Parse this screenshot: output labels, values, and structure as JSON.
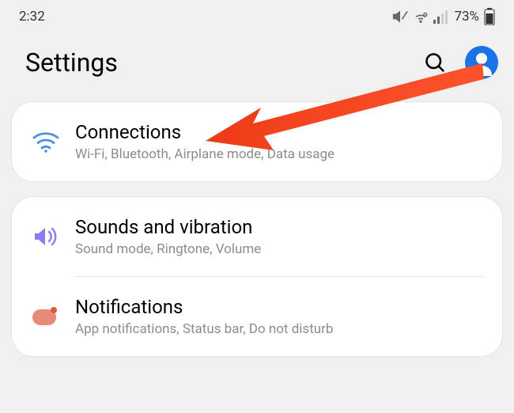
{
  "status_bar": {
    "time": "2:32",
    "battery_pct": "73%",
    "icons": [
      "mute",
      "wifi",
      "signal",
      "battery"
    ]
  },
  "header": {
    "title": "Settings"
  },
  "sections": {
    "connections": {
      "title": "Connections",
      "subtitle": "Wi-Fi, Bluetooth, Airplane mode, Data usage"
    },
    "sounds": {
      "title": "Sounds and vibration",
      "subtitle": "Sound mode, Ringtone, Volume"
    },
    "notifications": {
      "title": "Notifications",
      "subtitle": "App notifications, Status bar, Do not disturb"
    }
  },
  "annotation": {
    "points_to": "connections",
    "color": "#e8320f"
  }
}
